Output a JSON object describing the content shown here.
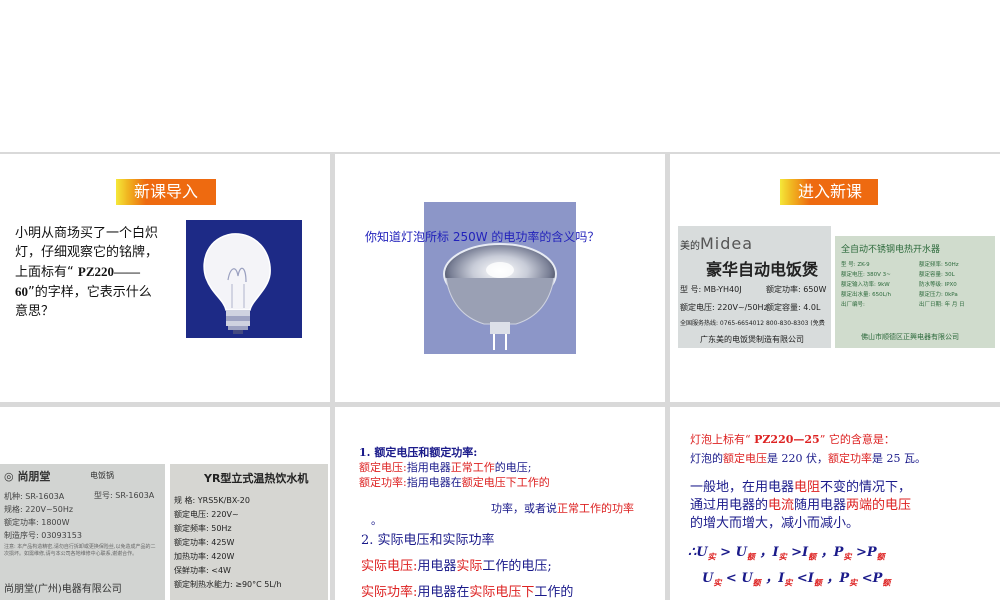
{
  "slide1": {
    "banner": "新课导入",
    "line1": "小明从商场买了一个白炽",
    "line2": "灯，仔细观察它的铭牌，",
    "line3_pre": "上面标有“ ",
    "line3_bold": "PZ220——",
    "line4_bold": "60",
    "line4_post": "”的字样，它表示什么",
    "line5": "意思？"
  },
  "slide2": {
    "question": "你知道灯泡所标 250W 的电功率的含义吗？"
  },
  "slide3": {
    "banner": "进入新课",
    "midea": {
      "brand_pre": "美的",
      "brand": "Midea",
      "title": "豪华自动电饭煲",
      "model": "型 号: MB-YH40J",
      "power": "额定功率: 650W",
      "voltage": "额定电压: 220V~/50Hz",
      "capacity": "额定容量: 4.0L",
      "hotline": "全国服务热线: 0765-6654012  800-830-8303 (免费",
      "maker": "广东美的电饭煲制造有限公司"
    },
    "heater": {
      "title": "全自动不锈钢电热开水器",
      "rows": [
        [
          "型 号: ZK-9",
          "额定频率: 50Hz"
        ],
        [
          "额定电压: 380V 3~",
          "额定容量: 30L"
        ],
        [
          "额定输入功率: 9kW",
          "防水等级: IPX0"
        ],
        [
          "额定出水量: 650L/h",
          "额定压力: 0kPa"
        ],
        [
          "出厂编号:",
          "出厂日期:  年  月  日"
        ]
      ],
      "maker": "佛山市顺德区正興电器有限公司"
    }
  },
  "slide4": {
    "cooker": {
      "brand": "尚朋堂",
      "kind": "电饭锅",
      "rows": [
        "机种: SR-1603A",
        "规格: 220V~50Hz",
        "额定功率: 1800W",
        "制造序号: 03093153"
      ],
      "model": "型号: SR-1603A",
      "note": "注意: 本产品构造精密,请勿自行拆卸或更换保险丝,以免造成产品的二次损坏。如需维修,请与本公司各地维修中心联系,谢谢合作。",
      "maker": "尚朋堂(广州)电器有限公司"
    },
    "water": {
      "title": "YR型立式温热饮水机",
      "rows": [
        "规    格: YRS5K/BX-20",
        "额定电压: 220V~",
        "额定频率: 50Hz",
        "额定功率: 425W",
        "加热功率: 420W",
        "保鲜功率: <4W",
        "额定制热水能力: ≥90°C 5L/h"
      ]
    }
  },
  "slide5": {
    "h1": "1. 额定电压和额定功率:",
    "v_label": "额定电压:",
    "v_pre": "指用电器",
    "v_red": "正常工作",
    "v_post": "的电压;",
    "p_label": "额定功率:",
    "p_pre": "指用电器在",
    "p_red": "额定电压下工作的",
    "p_cont": "功率，或者说",
    "p_red2": "正常工作的功率",
    "p_end": "。",
    "h2": "2. 实际电压和实际功率",
    "av_label": "实际电压:",
    "av_pre": "用电器",
    "av_red": "实际",
    "av_post": "工作的电压;",
    "ap_label": "实际功率:",
    "ap_pre": "用电器在",
    "ap_red": "实际电压下",
    "ap_post": "工作的"
  },
  "slide6": {
    "l1_pre": "灯泡上标有“ ",
    "l1_bold": "PZ220—25",
    "l1_post": "” 它的含意是：",
    "l2_pre": "灯泡的",
    "l2_red1": "额定电压",
    "l2_mid1": "是 220 伏，",
    "l2_red2": "额定功率",
    "l2_mid2": "是 25 瓦。",
    "p_l1_pre": "一般地，在用电器",
    "p_l1_red": "电阻",
    "p_l1_post": "不变的情况下，",
    "p_l2_pre": "通过用电器的",
    "p_l2_red1": "电流",
    "p_l2_mid": "随用电器",
    "p_l2_red2": "两端的电压",
    "p_l3": "的增大而增大，减小而减小。",
    "f1": "∴U",
    "f2": "U",
    "sub_shi": "实",
    "sub_e": "额",
    "gt": ">",
    "lt": "<",
    "I": "I",
    "P": "P"
  }
}
